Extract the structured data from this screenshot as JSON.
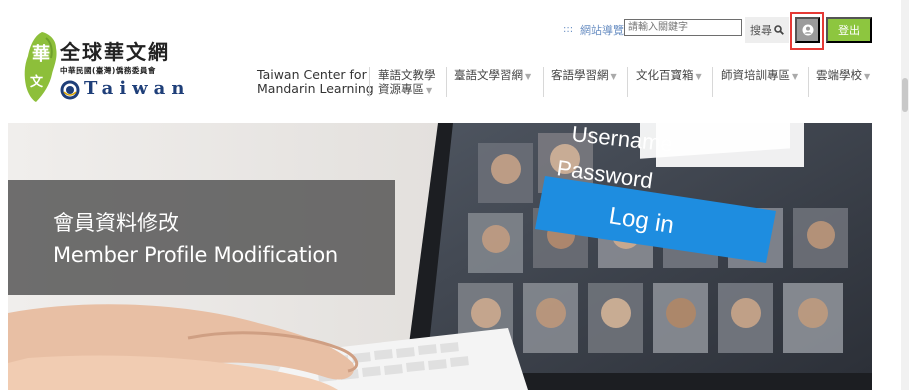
{
  "logo": {
    "badge_char": "華",
    "badge_char2": "文",
    "title": "全球華文網",
    "subtitle": "中華民國(臺灣)僑務委員會",
    "english": "Taiwan"
  },
  "topbar": {
    "sitemap_icon": ":::",
    "sitemap_label": "網站導覽",
    "search_placeholder": "請輸入關鍵字",
    "search_label": "搜尋",
    "login_label": "登出"
  },
  "nav": {
    "brand_line1": "Taiwan Center for",
    "brand_line2": "Mandarin Learning",
    "items": [
      {
        "label": "華語文教學",
        "label2": "資源專區"
      },
      {
        "label": "臺語文學習網"
      },
      {
        "label": "客語學習網"
      },
      {
        "label": "文化百寶箱"
      },
      {
        "label": "師資培訓專區"
      },
      {
        "label": "雲端學校"
      }
    ]
  },
  "hero": {
    "title_zh": "會員資料修改",
    "title_en": "Member Profile Modification",
    "screen_username": "Username",
    "screen_password": "Password",
    "screen_login": "Log in"
  },
  "colors": {
    "accent_green": "#8dc63f",
    "link_blue": "#6a8fc3",
    "highlight_red": "#e53935",
    "login_blue": "#1e8de0"
  }
}
